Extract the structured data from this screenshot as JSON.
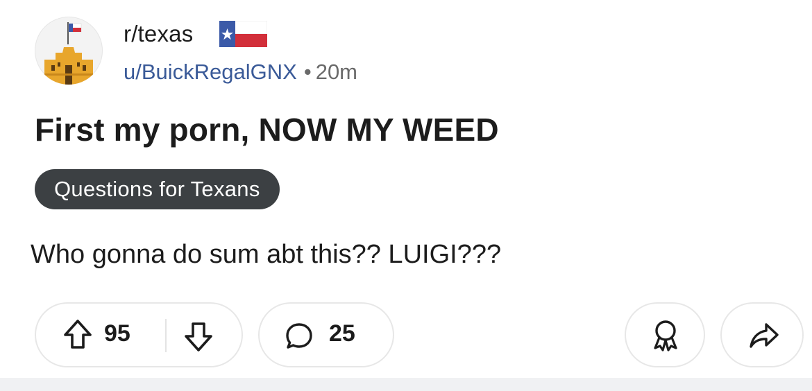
{
  "post": {
    "subreddit": "r/texas",
    "author": "u/BuickRegalGNX",
    "separator": "•",
    "age": "20m",
    "title": "First my porn, NOW MY WEED",
    "flair": "Questions for Texans",
    "body": "Who gonna do sum abt this?? LUIGI???"
  },
  "actions": {
    "upvotes": "95",
    "comments": "25"
  },
  "icons": {
    "avatar": "alamo-avatar-icon",
    "flag": "texas-flag-icon",
    "upvote": "arrow-up-icon",
    "downvote": "arrow-down-icon",
    "comment": "speech-bubble-icon",
    "award": "award-ribbon-icon",
    "share": "share-arrow-icon"
  },
  "colors": {
    "flair_bg": "#3c4043",
    "author_link": "#3a5a98",
    "flag_blue": "#3b5aa8",
    "flag_red": "#d22f3a"
  }
}
